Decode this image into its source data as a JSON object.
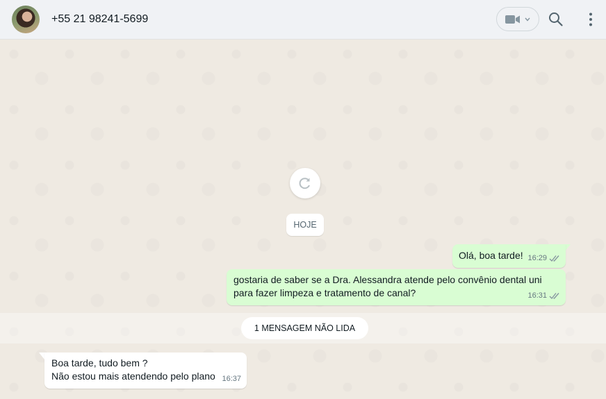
{
  "header": {
    "contact_name": "+55 21 98241-5699",
    "icons": [
      "avatar",
      "video-call-icon",
      "chevron-down-icon",
      "search-icon",
      "more-options-icon"
    ]
  },
  "chat": {
    "refresh_icon": "refresh-icon",
    "date_separator": "HOJE",
    "unread_banner": "1 MENSAGEM NÃO LIDA",
    "messages": [
      {
        "direction": "out",
        "text": "Olá, boa tarde!",
        "time": "16:29",
        "status": "read"
      },
      {
        "direction": "out",
        "text": "gostaria de saber se a Dra. Alessandra atende pelo convênio dental uni para fazer limpeza e tratamento de canal?",
        "time": "16:31",
        "status": "read"
      },
      {
        "direction": "in",
        "line1": "Boa tarde, tudo bem ?",
        "line2": "Não estou mais atendendo pelo plano",
        "time": "16:37"
      }
    ]
  },
  "colors": {
    "header_bg": "#f0f2f5",
    "chat_bg": "#efeae2",
    "outgoing_bubble": "#d9fdd3",
    "incoming_bubble": "#ffffff",
    "read_tick": "#8696a0"
  }
}
